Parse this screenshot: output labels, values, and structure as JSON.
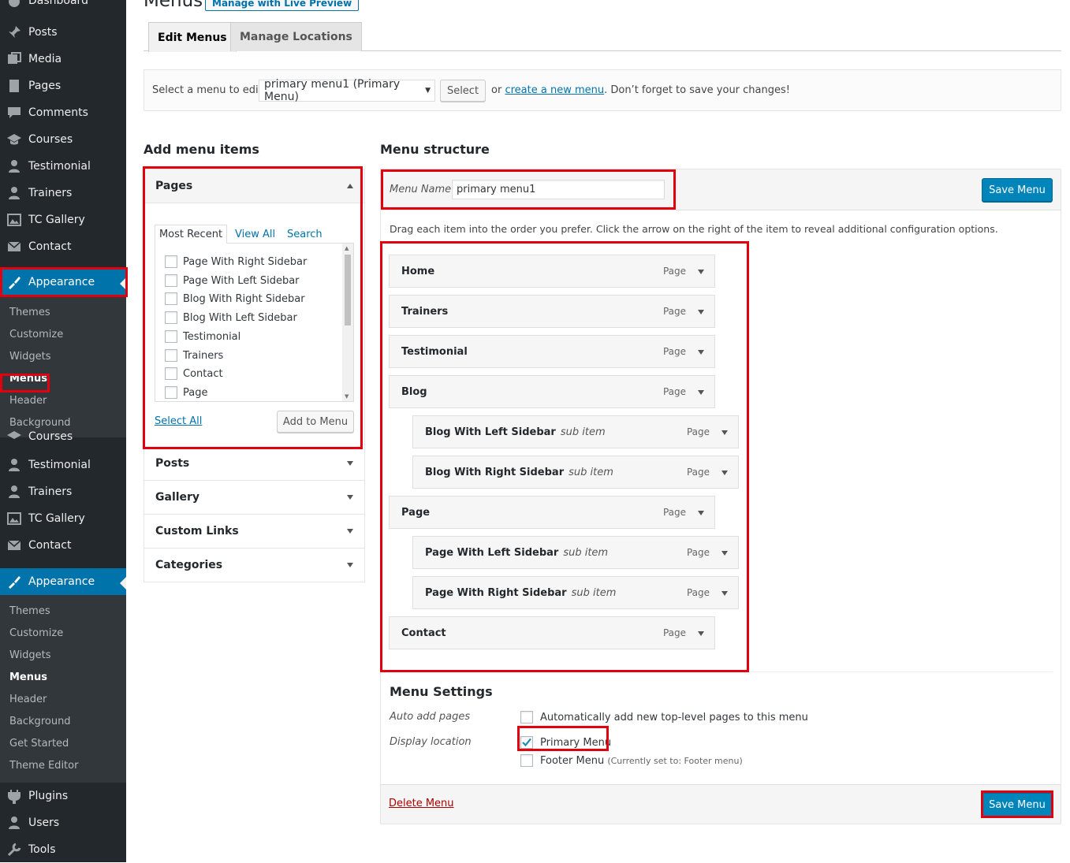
{
  "sidebar": {
    "top_partial": "Dashboard",
    "items_a": [
      {
        "label": "Posts",
        "icon": "pin-icon"
      },
      {
        "label": "Media",
        "icon": "media-icon"
      },
      {
        "label": "Pages",
        "icon": "page-icon"
      },
      {
        "label": "Comments",
        "icon": "comment-icon"
      },
      {
        "label": "Courses",
        "icon": "mortarboard-icon"
      },
      {
        "label": "Testimonial",
        "icon": "person-icon"
      },
      {
        "label": "Trainers",
        "icon": "person-icon"
      },
      {
        "label": "TC Gallery",
        "icon": "gallery-icon"
      },
      {
        "label": "Contact",
        "icon": "mail-icon"
      }
    ],
    "appearance": "Appearance",
    "sub_a": [
      "Themes",
      "Customize",
      "Widgets",
      "Menus",
      "Header",
      "Background"
    ],
    "overlap_partial": "Courses",
    "items_b": [
      {
        "label": "Testimonial",
        "icon": "person-icon"
      },
      {
        "label": "Trainers",
        "icon": "person-icon"
      },
      {
        "label": "TC Gallery",
        "icon": "gallery-icon"
      },
      {
        "label": "Contact",
        "icon": "mail-icon"
      }
    ],
    "sub_b": [
      "Themes",
      "Customize",
      "Widgets",
      "Menus",
      "Header",
      "Background",
      "Get Started",
      "Theme Editor"
    ],
    "items_c": [
      {
        "label": "Plugins",
        "icon": "plug-icon"
      },
      {
        "label": "Users",
        "icon": "person-icon"
      },
      {
        "label": "Tools",
        "icon": "wrench-icon"
      }
    ]
  },
  "header": {
    "title": "Menus",
    "live_preview": "Manage with Live Preview",
    "tabs": [
      "Edit Menus",
      "Manage Locations"
    ]
  },
  "manage": {
    "select_label": "Select a menu to edit:",
    "selected_menu": "primary menu1 (Primary Menu)",
    "select_button": "Select",
    "or_text": "or",
    "create_link": "create a new menu",
    "tail_text": ". Don’t forget to save your changes!"
  },
  "add_items": {
    "heading": "Add menu items",
    "pages": {
      "title": "Pages",
      "tabs": [
        "Most Recent",
        "View All",
        "Search"
      ],
      "items": [
        "Page With Right Sidebar",
        "Page With Left Sidebar",
        "Blog With Right Sidebar",
        "Blog With Left Sidebar",
        "Testimonial",
        "Trainers",
        "Contact",
        "Page"
      ],
      "select_all": "Select All",
      "add_button": "Add to Menu"
    },
    "panels": [
      "Posts",
      "Gallery",
      "Custom Links",
      "Categories"
    ]
  },
  "structure": {
    "heading": "Menu structure",
    "name_label": "Menu Name",
    "name_value": "primary menu1",
    "save": "Save Menu",
    "instructions": "Drag each item into the order you prefer. Click the arrow on the right of the item to reveal additional configuration options.",
    "items": [
      {
        "title": "Home",
        "sub": "",
        "kind": "Page"
      },
      {
        "title": "Trainers",
        "sub": "",
        "kind": "Page"
      },
      {
        "title": "Testimonial",
        "sub": "",
        "kind": "Page"
      },
      {
        "title": "Blog",
        "sub": "",
        "kind": "Page"
      },
      {
        "title": "Blog With Left Sidebar",
        "sub": "sub item",
        "kind": "Page"
      },
      {
        "title": "Blog With Right Sidebar",
        "sub": "sub item",
        "kind": "Page"
      },
      {
        "title": "Page",
        "sub": "",
        "kind": "Page"
      },
      {
        "title": "Page With Left Sidebar",
        "sub": "sub item",
        "kind": "Page"
      },
      {
        "title": "Page With Right Sidebar",
        "sub": "sub item",
        "kind": "Page"
      },
      {
        "title": "Contact",
        "sub": "",
        "kind": "Page"
      }
    ]
  },
  "settings": {
    "heading": "Menu Settings",
    "auto_label": "Auto add pages",
    "auto_text": "Automatically add new top-level pages to this menu",
    "auto_checked": false,
    "display_label": "Display location",
    "primary_text": "Primary Menu",
    "primary_checked": true,
    "footer_text": "Footer Menu",
    "footer_note": "(Currently set to: Footer menu)",
    "footer_checked": false,
    "delete": "Delete Menu",
    "save": "Save Menu"
  },
  "colors": {
    "sidebar_bg": "#23282d",
    "accent": "#0073aa",
    "primary_button": "#0085ba",
    "highlight": "#e2000f",
    "delete": "#a00"
  }
}
